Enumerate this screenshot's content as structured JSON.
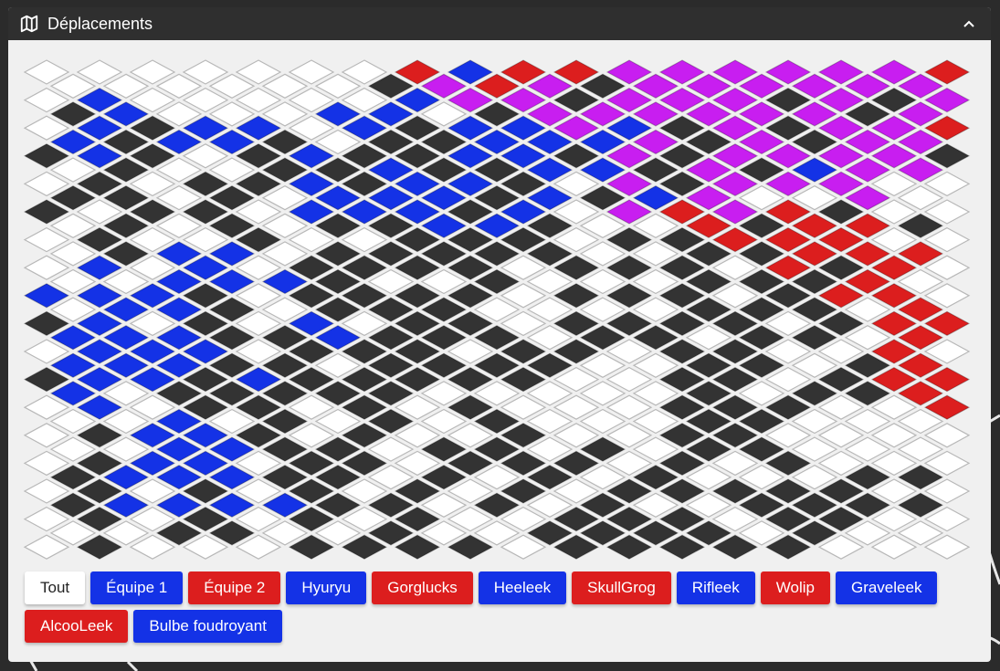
{
  "panel": {
    "title": "Déplacements",
    "icon": "map-icon",
    "collapse_icon": "chevron-up-icon"
  },
  "colors": {
    "empty": "#ffffff",
    "obstacle": "#333333",
    "team1": "#1432e6",
    "team2": "#dc1e1e",
    "mixed": "#c81ef0",
    "border": "#b8b8b8"
  },
  "grid": {
    "legend": {
      ".": "empty",
      "X": "obstacle",
      "B": "team1",
      "R": "team2",
      "M": "mixed"
    },
    "top_rows": [
      ".......RBRRMMMMMMR",
      "......XMRMXMMMMMMB",
      ".B.....BMMXMMMXMXM",
      "XB...BB.XMMMMMMXMB",
      ".BXBB.BXBBMBXMXMMR",
      "BXBBX.XXBBBMXMXMMR",
      "XBX.XBXXBBXMXMMMMX",
      ".X..XXBXXBBXMXBMMB",
      ".X.XXBXBBX.MXMMM..",
      "XX.X.BBBXBXBM..M.X",
      "X.XX.BBBXB.MRMRX..",
      ".X.X.XXBBX..RXRRX.",
      ".X..X..XXX.XXRRR..",
      ".XBB.XXXXX..XXRRRR",
      ".B.B.XXXX.XXX.RXR.",
      "..BBBX..X...XXXR..",
      "BBBX.XXXX.XXX.XRR.",
      ".BBX.XXX....XXX.RR",
      "XB.X.B.XX.XXXX.XRR",
      "BBBXXBXXX.XX.XX.R.",
      ".BBB.XXX.XX.XX..R.",
      "BBBXX.XXXX..XX.XRR",
      "XBBXBXXXXX..XX.XRR",
      "B.XXXXX.....X.XXRR",
      ".B.XX.X.X...XXX..R",
      "..B.X.X.X...XX...R",
      ".XBBX.X..X..XX....",
      "..BBXX.XX.X.XX....",
      ".XBB.XX.XXX.X.X...",
      "XBBBXX.X.X.X...XX.",
      ".X.X.X.X.X.XXXXX..",
      "XBBBBXX.X.X..XXXX.",
      ".X.X.X.X..XXX.XX..",
      "..XX..X..XXXX.X...",
      ".X...XXXX.XXXXX...",
      "........X.X..X.X.."
    ],
    "bottom_rows": [
      "......................",
      "......................",
      "......................",
      "......................",
      "......................",
      "......................",
      "......................",
      "......................",
      "......................",
      "......................",
      "......................",
      "......................",
      "......................",
      "......................",
      "......................",
      "......................",
      "......................",
      "......................",
      "......................",
      "......................",
      "......................",
      "......................",
      "......................",
      "......................",
      "......................",
      "......................",
      "......................",
      "......................",
      "......................",
      "......................",
      "......................",
      "......................",
      "......................",
      "......................",
      "......................"
    ]
  },
  "filters": [
    {
      "label": "Tout",
      "style": "white"
    },
    {
      "label": "Équipe 1",
      "style": "blue"
    },
    {
      "label": "Équipe 2",
      "style": "red"
    },
    {
      "label": "Hyuryu",
      "style": "blue"
    },
    {
      "label": "Gorglucks",
      "style": "red"
    },
    {
      "label": "Heeleek",
      "style": "blue"
    },
    {
      "label": "SkullGrog",
      "style": "red"
    },
    {
      "label": "Rifleek",
      "style": "blue"
    },
    {
      "label": "Wolip",
      "style": "red"
    },
    {
      "label": "Graveleek",
      "style": "blue"
    },
    {
      "label": "AlcooLeek",
      "style": "red"
    },
    {
      "label": "Bulbe foudroyant",
      "style": "blue"
    }
  ]
}
